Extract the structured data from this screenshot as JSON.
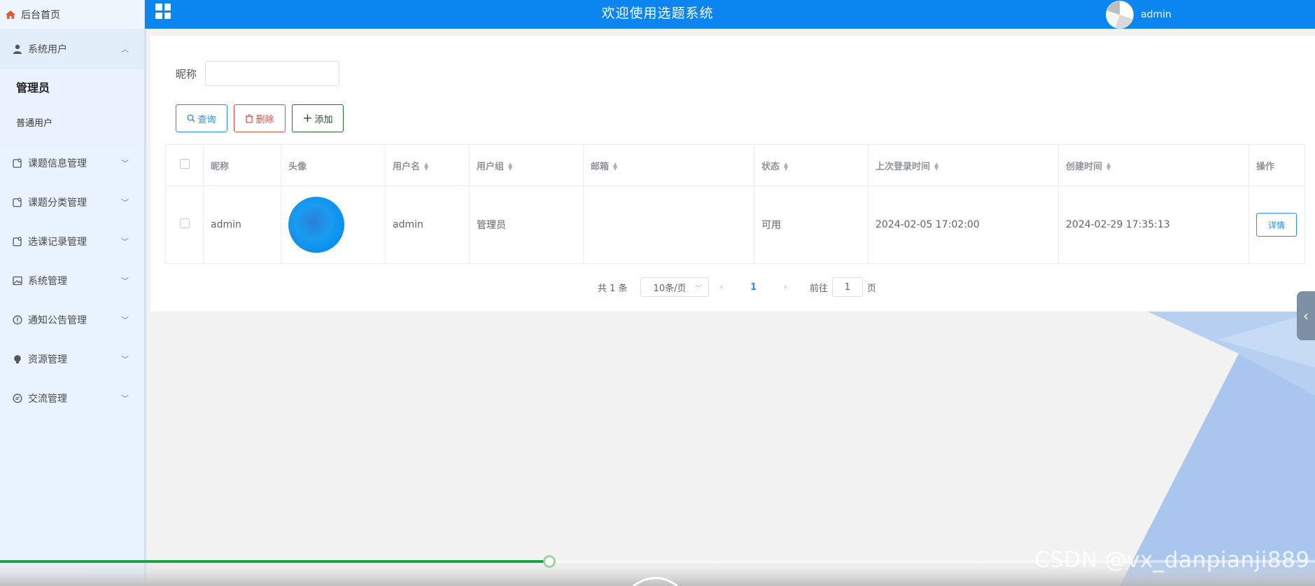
{
  "header": {
    "home_label": "后台首页",
    "site_title": "欢迎使用选题系统",
    "username": "admin",
    "accent_color": "#0b85f0"
  },
  "sidebar": {
    "groups": [
      {
        "label": "系统用户",
        "icon": "user-icon",
        "expanded": true,
        "children": [
          {
            "label": "管理员",
            "active": true
          },
          {
            "label": "普通用户",
            "active": false
          }
        ]
      },
      {
        "label": "课题信息管理",
        "icon": "tag-icon"
      },
      {
        "label": "课题分类管理",
        "icon": "tag-icon"
      },
      {
        "label": "选课记录管理",
        "icon": "tag-icon"
      },
      {
        "label": "系统管理",
        "icon": "picture-icon"
      },
      {
        "label": "通知公告管理",
        "icon": "info-icon"
      },
      {
        "label": "资源管理",
        "icon": "bulb-icon"
      },
      {
        "label": "交流管理",
        "icon": "chat-icon"
      }
    ]
  },
  "search": {
    "label": "昵称",
    "value": ""
  },
  "toolbar": {
    "query_label": "查询",
    "delete_label": "删除",
    "add_label": "添加"
  },
  "table": {
    "columns": [
      "昵称",
      "头像",
      "用户名",
      "用户组",
      "邮箱",
      "状态",
      "上次登录时间",
      "创建时间",
      "操作"
    ],
    "rows": [
      {
        "nickname": "admin",
        "username": "admin",
        "group": "管理员",
        "email": "",
        "status": "可用",
        "last_login": "2024-02-05 17:02:00",
        "created": "2024-02-29 17:35:13",
        "action_label": "详情"
      }
    ]
  },
  "pagination": {
    "total_text": "共 1 条",
    "page_size": "10条/页",
    "current_page": "1",
    "goto_prefix": "前往",
    "goto_value": "1",
    "goto_suffix": "页"
  },
  "player": {
    "progress_fraction": 0.418,
    "progress_color": "#1aa34a"
  },
  "watermark": "CSDN @vx_danpianji889"
}
